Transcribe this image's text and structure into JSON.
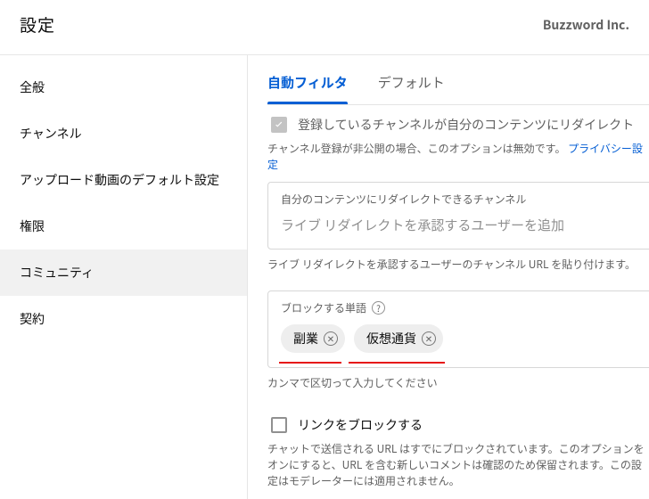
{
  "header": {
    "title": "設定",
    "brand": "Buzzword Inc."
  },
  "sidebar": {
    "items": [
      {
        "label": "全般"
      },
      {
        "label": "チャンネル"
      },
      {
        "label": "アップロード動画のデフォルト設定"
      },
      {
        "label": "権限"
      },
      {
        "label": "コミュニティ"
      },
      {
        "label": "契約"
      }
    ],
    "active_index": 4
  },
  "tabs": {
    "items": [
      {
        "label": "自動フィルタ"
      },
      {
        "label": "デフォルト"
      }
    ],
    "active_index": 0
  },
  "redirect_section": {
    "checkbox_label": "登録しているチャンネルが自分のコンテンツにリダイレクト",
    "help_text_before": "チャンネル登録が非公開の場合、このオプションは無効です。",
    "help_link": "プライバシー設定",
    "panel_title": "自分のコンテンツにリダイレクトできるチャンネル",
    "panel_placeholder": "ライブ リダイレクトを承認するユーザーを追加",
    "panel_help": "ライブ リダイレクトを承認するユーザーのチャンネル URL を貼り付けます。"
  },
  "blocked_words": {
    "label": "ブロックする単語",
    "chips": [
      "副業",
      "仮想通貨"
    ],
    "help": "カンマで区切って入力してください"
  },
  "block_links": {
    "label": "リンクをブロックする",
    "help": "チャットで送信される URL はすでにブロックされています。このオプションをオンにすると、URL を含む新しいコメントは確認のため保留されます。この設定はモデレーターには適用されません。"
  }
}
